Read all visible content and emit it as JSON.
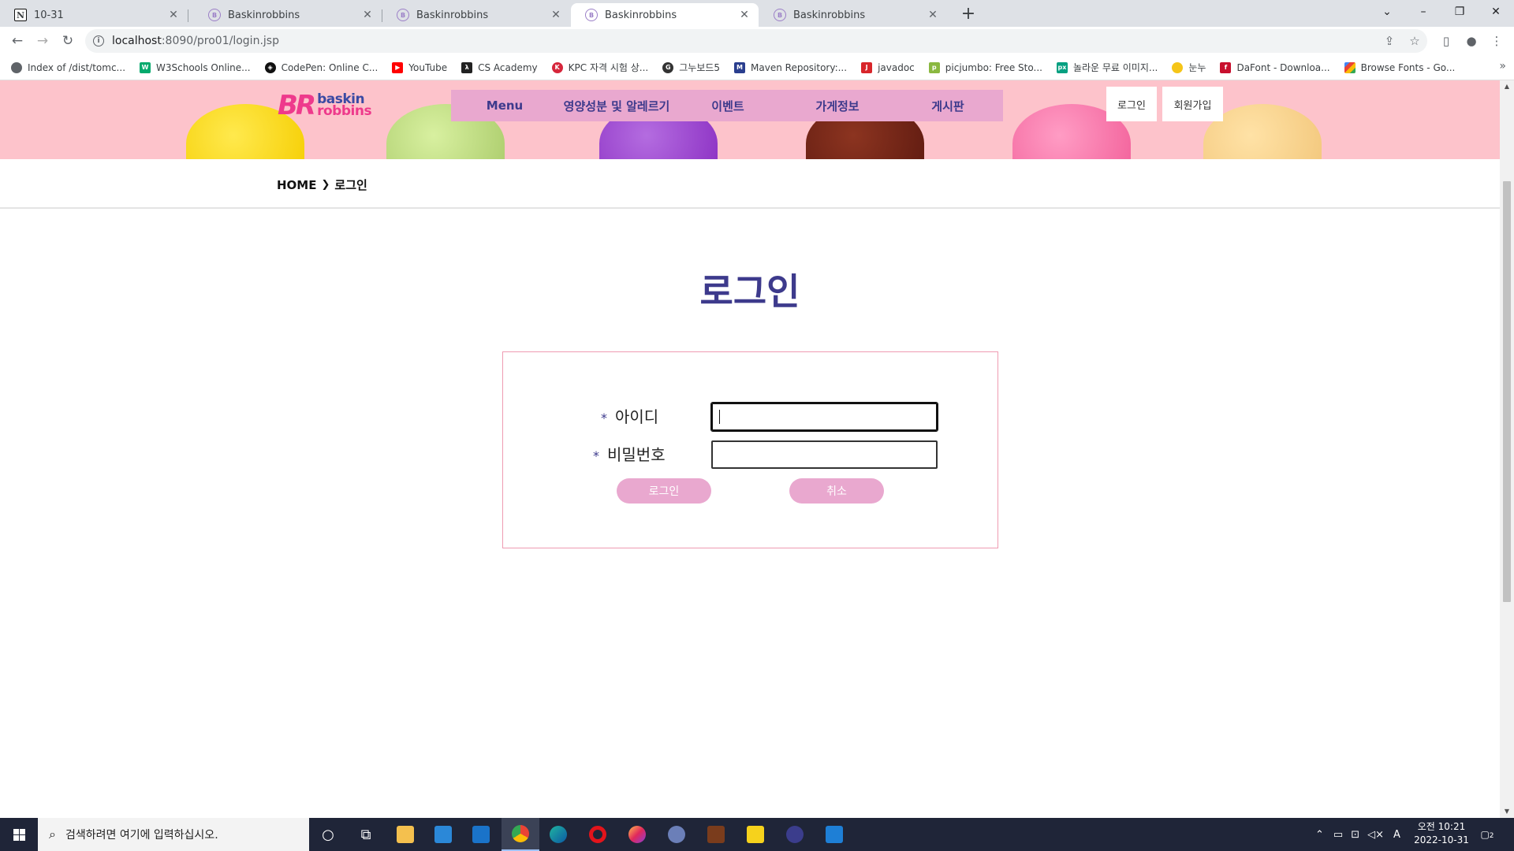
{
  "browser": {
    "tabs": [
      {
        "title": "10-31",
        "favicon": "notion-icon"
      },
      {
        "title": "Baskinrobbins",
        "favicon": "baskinrobbins-icon"
      },
      {
        "title": "Baskinrobbins",
        "favicon": "baskinrobbins-icon"
      },
      {
        "title": "Baskinrobbins",
        "favicon": "baskinrobbins-icon",
        "active": true
      },
      {
        "title": "Baskinrobbins",
        "favicon": "baskinrobbins-icon"
      }
    ],
    "url_host": "localhost",
    "url_rest": ":8090/pro01/login.jsp",
    "bookmarks": [
      {
        "label": "Index of /dist/tomc...",
        "icon": "globe-icon"
      },
      {
        "label": "W3Schools Online...",
        "icon": "w3schools-icon"
      },
      {
        "label": "CodePen: Online C...",
        "icon": "codepen-icon"
      },
      {
        "label": "YouTube",
        "icon": "youtube-icon"
      },
      {
        "label": "CS Academy",
        "icon": "cs-academy-icon"
      },
      {
        "label": "KPC 자격 시험 상...",
        "icon": "kpc-icon"
      },
      {
        "label": "그누보드5",
        "icon": "gnuboard-icon"
      },
      {
        "label": "Maven Repository:...",
        "icon": "maven-icon"
      },
      {
        "label": "javadoc",
        "icon": "javadoc-icon"
      },
      {
        "label": "picjumbo: Free Sto...",
        "icon": "picjumbo-icon"
      },
      {
        "label": "놀라운 무료 이미지...",
        "icon": "pexels-icon"
      },
      {
        "label": "눈누",
        "icon": "noonnu-icon"
      },
      {
        "label": "DaFont - Downloa...",
        "icon": "dafont-icon"
      },
      {
        "label": "Browse Fonts - Go...",
        "icon": "google-fonts-icon"
      }
    ]
  },
  "site": {
    "logo_mark": "BR",
    "logo_word1": "baskin",
    "logo_word2": "robbins",
    "nav": [
      "Menu",
      "영양성분 및 알레르기",
      "이벤트",
      "가게정보",
      "게시판"
    ],
    "login_link": "로그인",
    "signup_link": "회원가입",
    "breadcrumb_home": "HOME",
    "breadcrumb_current": "로그인",
    "page_title": "로그인",
    "form": {
      "required_mark": "*",
      "id_label": "아이디",
      "password_label": "비밀번호",
      "id_value": "",
      "password_value": "",
      "submit_label": "로그인",
      "cancel_label": "취소"
    }
  },
  "taskbar": {
    "search_placeholder": "검색하려면 여기에 입력하십시오.",
    "clock_time": "오전 10:21",
    "clock_date": "2022-10-31",
    "notification_count": "2",
    "ime_indicator": "A"
  },
  "colors": {
    "header_pink": "#fdc3cb",
    "nav_pink": "#e9a8cf",
    "brand_navy": "#3d3a8c",
    "box_border": "#ef9bb2"
  }
}
